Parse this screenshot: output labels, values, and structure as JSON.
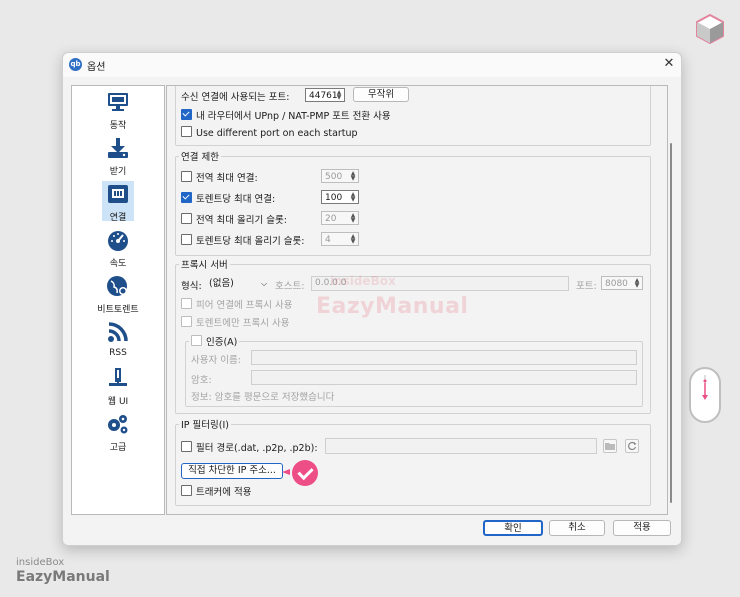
{
  "window": {
    "title": "옵션"
  },
  "sidebar": {
    "items": [
      {
        "label": "동작",
        "icon": "monitor-icon"
      },
      {
        "label": "받기",
        "icon": "download-icon"
      },
      {
        "label": "연결",
        "icon": "network-icon"
      },
      {
        "label": "속도",
        "icon": "speedometer-icon"
      },
      {
        "label": "비트토렌트",
        "icon": "globe-icon"
      },
      {
        "label": "RSS",
        "icon": "rss-icon"
      },
      {
        "label": "웹 UI",
        "icon": "webui-icon"
      },
      {
        "label": "고급",
        "icon": "gears-icon"
      }
    ],
    "selected_index": 2
  },
  "listening": {
    "port_label": "수신 연결에 사용되는 포트:",
    "port_value": "44761",
    "random_label": "무작위",
    "upnp_label": "내 라우터에서 UPnp / NAT-PMP 포트 전환 사용",
    "upnp_checked": true,
    "diff_port_label": "Use different port on each startup",
    "diff_port_checked": false
  },
  "conn_limits": {
    "title": "연결 제한",
    "rows": [
      {
        "label": "전역 최대 연결:",
        "value": "500",
        "checked": false
      },
      {
        "label": "토렌트당 최대 연결:",
        "value": "100",
        "checked": true
      },
      {
        "label": "전역 최대 올리기 슬롯:",
        "value": "20",
        "checked": false
      },
      {
        "label": "토렌트당 최대 올리기 슬롯:",
        "value": "4",
        "checked": false
      }
    ]
  },
  "proxy": {
    "title": "프록시 서버",
    "type_label": "형식:",
    "type_value": "(없음)",
    "host_label": "호스트:",
    "host_value": "0.0.0.0",
    "port_label": "포트:",
    "port_value": "8080",
    "peer_label": "피어 연결에 프록시 사용",
    "torrent_only_label": "토렌트에만 프록시 사용",
    "auth_label": "인증(A)",
    "username_label": "사용자 이름:",
    "password_label": "암호:",
    "info": "정보: 암호를 평문으로 저장했습니다"
  },
  "ip_filter": {
    "title": "IP 필터링(I)",
    "path_label": "필터 경로(.dat, .p2p, .p2b):",
    "blocked_button": "직접 차단한 IP 주소...",
    "tracker_label": "트래커에 적용"
  },
  "footer": {
    "ok": "확인",
    "cancel": "취소",
    "apply": "적용"
  },
  "overlay": {
    "watermark_small": "insideBox",
    "watermark": "EazyManual",
    "brand_top": "insideBox",
    "brand_bottom": "EazyManual"
  }
}
